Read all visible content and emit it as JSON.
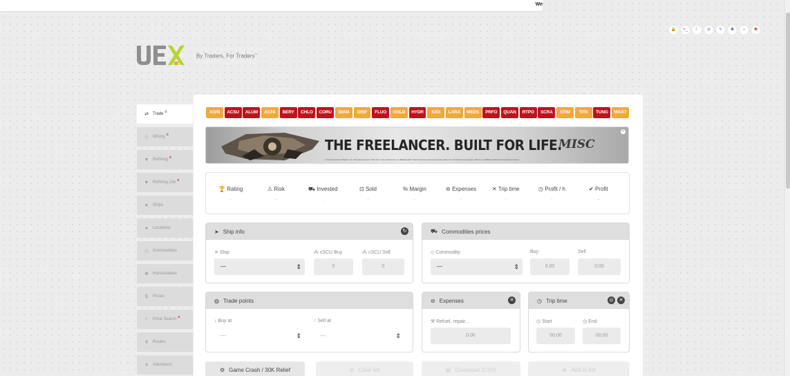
{
  "topbar": {
    "text": "We"
  },
  "top_icons": [
    {
      "icon": "lock-icon",
      "glyph": "🔒"
    },
    {
      "icon": "terminal-icon",
      "glyph": ">_"
    },
    {
      "icon": "moon-icon",
      "glyph": "☾"
    },
    {
      "icon": "target-icon",
      "glyph": "◎"
    },
    {
      "icon": "bolt-icon",
      "glyph": "ϟ"
    },
    {
      "icon": "bug-icon",
      "glyph": "✱"
    },
    {
      "icon": "headset-icon",
      "glyph": "∩"
    },
    {
      "icon": "plus-icon",
      "glyph": "✚"
    }
  ],
  "logo": {
    "text": "UEX"
  },
  "tagline": {
    "text": "By Traders, For Traders",
    "mark": "™"
  },
  "sidebar": {
    "items": [
      {
        "label": "Trade",
        "glyph": "⇄",
        "alpha": "α",
        "active": true
      },
      {
        "label": "Mining",
        "glyph": "◇",
        "alpha": "α"
      },
      {
        "label": "Refining",
        "glyph": "▼",
        "alpha": "α"
      },
      {
        "label": "Refining Job",
        "glyph": "▼",
        "alpha": "α"
      },
      {
        "label": "Ships",
        "glyph": "➤",
        "alpha": ""
      },
      {
        "label": "Locations",
        "glyph": "●",
        "alpha": ""
      },
      {
        "label": "Commodities",
        "glyph": "◇",
        "alpha": ""
      },
      {
        "label": "Harvestables",
        "glyph": "❀",
        "alpha": ""
      },
      {
        "label": "Prices",
        "glyph": "$",
        "alpha": ""
      },
      {
        "label": "Price Search",
        "glyph": "⌕",
        "alpha": "α"
      },
      {
        "label": "Routes",
        "glyph": "⇞",
        "alpha": ""
      },
      {
        "label": "Volunteers",
        "glyph": "✕",
        "alpha": ""
      }
    ]
  },
  "commodities": [
    {
      "label": "AGRI",
      "color": "yellow"
    },
    {
      "label": "ACSU",
      "color": "red"
    },
    {
      "label": "ALUM",
      "color": "red"
    },
    {
      "label": "ASTA",
      "color": "yellow"
    },
    {
      "label": "BERY",
      "color": "red"
    },
    {
      "label": "CHLO",
      "color": "red"
    },
    {
      "label": "CORU",
      "color": "red"
    },
    {
      "label": "DIAM",
      "color": "yellow"
    },
    {
      "label": "DISP",
      "color": "yellow"
    },
    {
      "label": "FLUO",
      "color": "red"
    },
    {
      "label": "GOLD",
      "color": "yellow"
    },
    {
      "label": "HYDR",
      "color": "red"
    },
    {
      "label": "IODI",
      "color": "yellow"
    },
    {
      "label": "LARA",
      "color": "yellow"
    },
    {
      "label": "MEDS",
      "color": "yellow"
    },
    {
      "label": "PRFO",
      "color": "red"
    },
    {
      "label": "QUAN",
      "color": "red"
    },
    {
      "label": "RTPO",
      "color": "red"
    },
    {
      "label": "SCRA",
      "color": "red"
    },
    {
      "label": "STIM",
      "color": "yellow"
    },
    {
      "label": "TITA",
      "color": "yellow"
    },
    {
      "label": "TUNG",
      "color": "red"
    },
    {
      "label": "WAST",
      "color": "yellow"
    }
  ],
  "banner": {
    "headline": "THE FREELANCER. BUILT FOR LIFE.",
    "brand": "MISC",
    "fine_print": "© Cloud Imperium Rights LLC. All rights reserved. This site is not endorsed by or affiliated with Cloud Imperium Games and was made for entertainment purposes. UEX is not affiliated with Cloud Imperium Games."
  },
  "stats": [
    {
      "label": "Rating",
      "glyph": "🏆",
      "value": "-"
    },
    {
      "label": "Risk",
      "glyph": "⚠",
      "value": "-"
    },
    {
      "label": "Invested",
      "glyph": "⛟",
      "value": "-"
    },
    {
      "label": "Sold",
      "glyph": "⊡",
      "value": "-"
    },
    {
      "label": "Margin",
      "glyph": "%",
      "value": "-"
    },
    {
      "label": "Expenses",
      "glyph": "⊖",
      "value": "-"
    },
    {
      "label": "Trip time",
      "glyph": "✕",
      "value": "-"
    },
    {
      "label": "Profit / h",
      "glyph": "◷",
      "value": "-"
    },
    {
      "label": "Profit",
      "glyph": "✔",
      "value": "-"
    }
  ],
  "ship_info": {
    "title": "Ship info",
    "ship_label": "Ship",
    "ship_value": "—",
    "buy_label": "cSCU Buy",
    "buy_value": "0",
    "sell_label": "cSCU Sell",
    "sell_value": "0"
  },
  "commodity_prices": {
    "title": "Commodities prices",
    "commodity_label": "Commodity",
    "commodity_value": "—",
    "buy_label": "Buy",
    "buy_value": "0.00",
    "sell_label": "Sell",
    "sell_value": "0.00"
  },
  "trade_points": {
    "title": "Trade points",
    "buy_label": "Buy at",
    "buy_value": "—",
    "sell_label": "Sell at",
    "sell_value": "—"
  },
  "expenses": {
    "title": "Expenses",
    "field_label": "Refuel, repair...",
    "field_value": "0.00"
  },
  "trip_time": {
    "title": "Trip time",
    "start_label": "Start",
    "start_value": "00:00",
    "end_label": "End",
    "end_value": "00:00"
  },
  "actions": [
    {
      "label": "Game Crash / 30K Relief",
      "glyph": "⚙",
      "dim": false
    },
    {
      "label": "Clear list",
      "glyph": "⊘",
      "dim": true
    },
    {
      "label": "Download (CSV)",
      "glyph": "▤",
      "dim": true
    },
    {
      "label": "Add to list",
      "glyph": "⊕",
      "dim": true
    }
  ],
  "colors": {
    "accent_yellow": "#f0a93c",
    "accent_red": "#c0111d",
    "logo_gray": "#8f8f8f",
    "logo_green": "#b8d431",
    "profit_green": "#2a9d5b"
  }
}
